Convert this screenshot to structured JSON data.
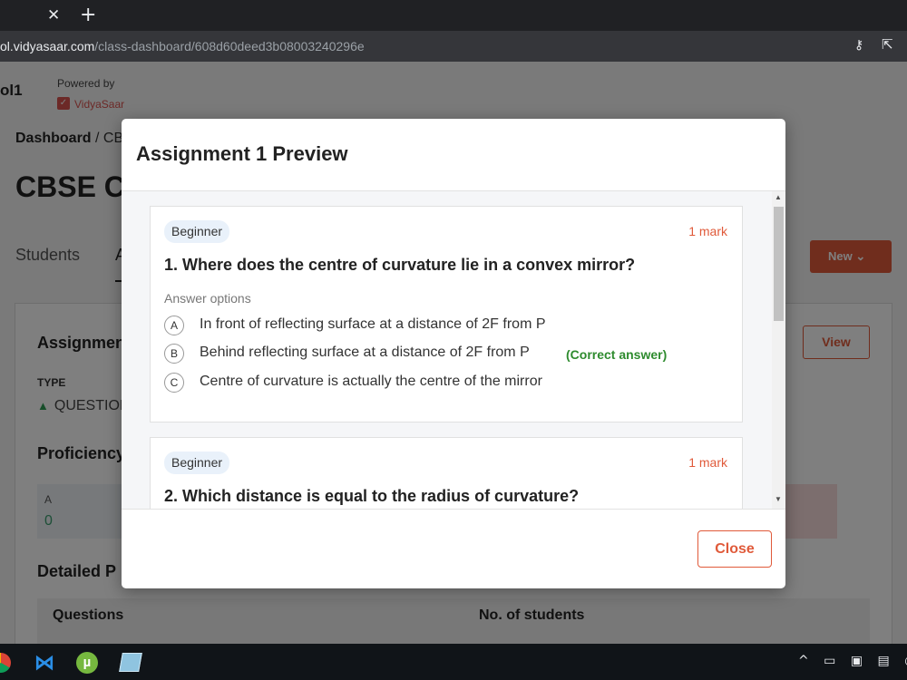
{
  "browser": {
    "tab_close": "✕",
    "tab_new": "+",
    "url_host": "ol.vidyasaar.com",
    "url_path": "/class-dashboard/608d60deed3b08003240296e",
    "key_icon": "key-icon",
    "share_icon": "share-icon"
  },
  "page": {
    "school_name": "ol1",
    "powered_by": "Powered by",
    "brand": "VidyaSaar",
    "breadcrumb_root": "Dashboard",
    "breadcrumb_rest": " / CB",
    "class_title": "CBSE Cl",
    "tab_students": "Students",
    "tab_a": "A",
    "new_button": "New",
    "assignment_title": "Assignmen",
    "view_button": "View",
    "type_label": "TYPE",
    "type_value": "QUESTION",
    "proficiency_title": "Proficiency",
    "prof_a_label": "A",
    "prof_a_value": "0",
    "detailed_title": "Detailed P",
    "col_questions": "Questions",
    "col_students": "No. of students"
  },
  "modal": {
    "title": "Assignment 1 Preview",
    "close_button": "Close",
    "questions": [
      {
        "level": "Beginner",
        "marks": "1 mark",
        "text": "1. Where does the centre of curvature lie in a convex mirror?",
        "answer_label": "Answer options",
        "options": [
          {
            "letter": "A",
            "text": "In front of reflecting surface at a distance of 2F from P"
          },
          {
            "letter": "B",
            "text": "Behind reflecting surface at a distance of 2F from P",
            "correct": "(Correct answer)"
          },
          {
            "letter": "C",
            "text": "Centre of curvature is actually the centre of the mirror"
          }
        ]
      },
      {
        "level": "Beginner",
        "marks": "1 mark",
        "text": "2. Which distance is equal to the radius of curvature?"
      }
    ]
  },
  "taskbar": {
    "apps": [
      "chrome-icon",
      "vscode-icon",
      "utorrent-icon",
      "notes-icon"
    ],
    "tray_glyphs": "^ ▭ ▣ ▤ ◔"
  },
  "colors": {
    "accent": "#e05a3a",
    "correct": "#2e8b2e",
    "level_badge": "#e9f1fa"
  }
}
